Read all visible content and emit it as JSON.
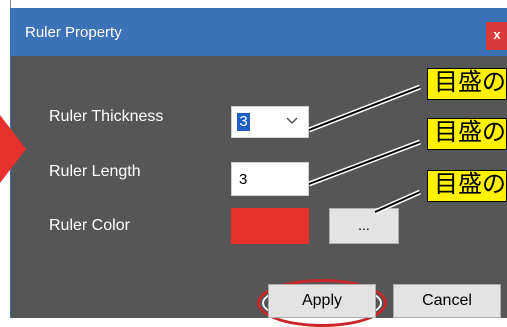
{
  "dialog": {
    "title": "Ruler Property",
    "close_label": "x",
    "fields": {
      "thickness_label": "Ruler Thickness",
      "thickness_value": "3",
      "length_label": "Ruler Length",
      "length_value": "3",
      "color_label": "Ruler Color",
      "color_value": "#e8302c",
      "color_button_label": "..."
    },
    "buttons": {
      "apply": "Apply",
      "cancel": "Cancel"
    }
  },
  "annotations": {
    "callouts": [
      "目盛の",
      "目盛の",
      "目盛の"
    ],
    "callout_color": "#fff100",
    "highlight_color": "#c9262b",
    "arrow_color": "#e8302c"
  }
}
